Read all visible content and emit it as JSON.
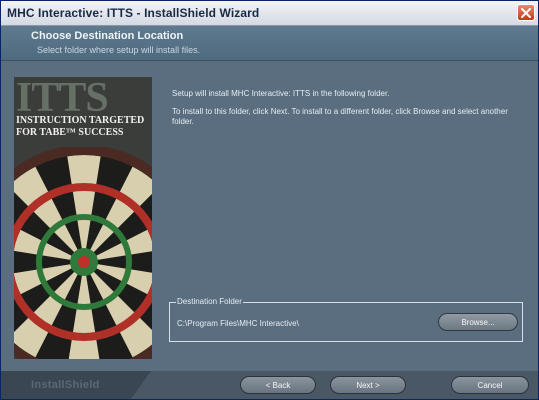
{
  "window": {
    "title": "MHC Interactive: ITTS - InstallShield Wizard"
  },
  "header": {
    "title": "Choose Destination Location",
    "subtitle": "Select folder where setup will install files."
  },
  "banner": {
    "logo_text": "ITTS",
    "tagline_line1": "INSTRUCTION TARGETED",
    "tagline_line2": "FOR TABE™ SUCCESS"
  },
  "body": {
    "line1": "Setup will install MHC Interactive: ITTS in the following folder.",
    "line2": "To install to this folder, click Next. To install to a different folder, click Browse and select another folder."
  },
  "destination": {
    "legend": "Destination Folder",
    "path": "C:\\Program Files\\MHC Interactive\\",
    "browse_label": "Browse..."
  },
  "footer": {
    "brand": "InstallShield",
    "back_label": "< Back",
    "next_label": "Next >",
    "cancel_label": "Cancel"
  },
  "colors": {
    "panel": "#5a6e7f",
    "header": "#577186",
    "footer": "#3a4652"
  }
}
